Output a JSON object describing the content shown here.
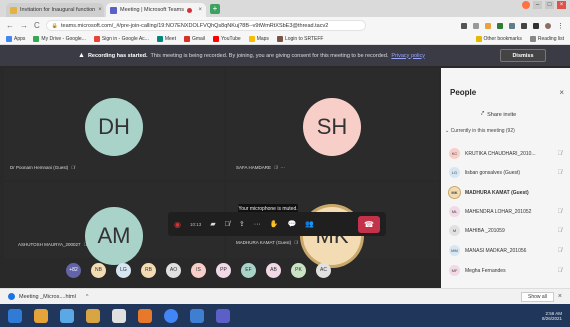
{
  "browser": {
    "tabs": [
      {
        "label": "Invitation for Inaugural function",
        "close": "×",
        "favicon_color": "#e3b341"
      },
      {
        "label": "Meeting | Microsoft Teams",
        "close": "×",
        "favicon_color": "#5b5fc7",
        "recording_dot_color": "#d13438"
      }
    ],
    "new_tab": "+",
    "url": "teams.microsoft.com/_#/pre-join-calling/19:NO7ENXDOLFVQhQs8qNKuj?8B--v9tWmRtXSbE3@thread.tacv2",
    "bookmarks": [
      "Apps",
      "My Drive - Google...",
      "Sign in - Google Ac...",
      "Meet",
      "Gmail",
      "YouTube",
      "Maps",
      "Login to SRTEFF"
    ],
    "bookmarks_right": [
      "Other bookmarks",
      "Reading list"
    ]
  },
  "banner": {
    "bold": "Recording has started.",
    "text": " This meeting is being recorded. By joining, you are giving consent for this meeting to be recorded.",
    "link": "Privacy policy",
    "dismiss": "Dismiss"
  },
  "tiles": [
    {
      "initials": "DH",
      "name": "Dr Poonam Hemnani (Guest)",
      "color": "#a9d3c9"
    },
    {
      "initials": "SH",
      "name": "SAFA HAMDARE",
      "color": "#f7cfc8",
      "more": "···"
    },
    {
      "initials": "AM",
      "name": "ASHUTOSH MAURYA_200027",
      "color": "#a9d3c9"
    },
    {
      "initials": "MK",
      "name": "MADHURA KAMAT (Guest)",
      "color": "#f3dcb4"
    }
  ],
  "toolbar": {
    "time": "10:13",
    "tooltip": "Your microphone is muted."
  },
  "strip": [
    {
      "initials": "+82",
      "color": "#6264a7",
      "text_color": "#ffffff"
    },
    {
      "initials": "NB",
      "color": "#f3dcb4"
    },
    {
      "initials": "LG",
      "color": "#d6e7f3"
    },
    {
      "initials": "RB",
      "color": "#f3dcb4"
    },
    {
      "initials": "AO",
      "color": "#e1e1e1"
    },
    {
      "initials": "IS",
      "color": "#f7cfc8"
    },
    {
      "initials": "PP",
      "color": "#f1d9e5"
    },
    {
      "initials": "EF",
      "color": "#a9d3c9"
    },
    {
      "initials": "AB",
      "color": "#f1d9e5"
    },
    {
      "initials": "PK",
      "color": "#c9e3c4"
    },
    {
      "initials": "AC",
      "color": "#e1e1e1"
    }
  ],
  "people": {
    "title": "People",
    "share": "Share invite",
    "section": "Currently in this meeting (92)",
    "list": [
      {
        "initials": "KC",
        "name": "KRUTIKA CHAUDHARI_2010...",
        "color": "#f7cfc8",
        "bold": false
      },
      {
        "initials": "LG",
        "name": "lisban gonsalves (Guest)",
        "color": "#d6e7f3",
        "bold": false
      },
      {
        "initials": "MK",
        "name": "MADHURA KAMAT (Guest)",
        "color": "#f3dcb4",
        "bold": true
      },
      {
        "initials": "ML",
        "name": "MAHENDRA LOHAR_201052",
        "color": "#f1d9e5",
        "bold": false
      },
      {
        "initials": "M",
        "name": "MAHIBA _201059",
        "color": "#e1e1e1",
        "bold": false
      },
      {
        "initials": "MM",
        "name": "MANASI MADKAR_201056",
        "color": "#d6e7f3",
        "bold": false
      },
      {
        "initials": "MF",
        "name": "Megha Fernandes",
        "color": "#f1d9e5",
        "bold": false
      }
    ]
  },
  "download": {
    "file": "Meeting _Micros....html",
    "chevron": "^",
    "show_all": "Show all",
    "close": "×"
  },
  "taskbar": {
    "time": "2:56 AM",
    "date": "8/26/2021"
  }
}
